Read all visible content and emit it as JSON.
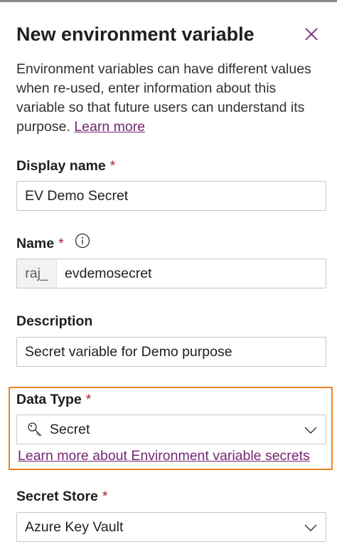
{
  "panel": {
    "title": "New environment variable",
    "intro_text": "Environment variables can have different values when re-used, enter information about this variable so that future users can understand its purpose.",
    "intro_link": "Learn more"
  },
  "fields": {
    "display_name": {
      "label": "Display name",
      "required": "*",
      "value": "EV Demo Secret"
    },
    "name": {
      "label": "Name",
      "required": "*",
      "prefix": "raj_",
      "value": "evdemosecret"
    },
    "description": {
      "label": "Description",
      "value": "Secret variable for Demo purpose"
    },
    "data_type": {
      "label": "Data Type",
      "required": "*",
      "value": "Secret",
      "help_link": "Learn more about Environment variable secrets"
    },
    "secret_store": {
      "label": "Secret Store",
      "required": "*",
      "value": "Azure Key Vault"
    }
  },
  "icons": {
    "close": "close-icon",
    "info": "info-icon",
    "key": "key-icon",
    "chevron": "chevron-down-icon"
  },
  "colors": {
    "link": "#742774",
    "required": "#a4262c",
    "highlight": "#f08322",
    "close_icon": "#742774"
  }
}
